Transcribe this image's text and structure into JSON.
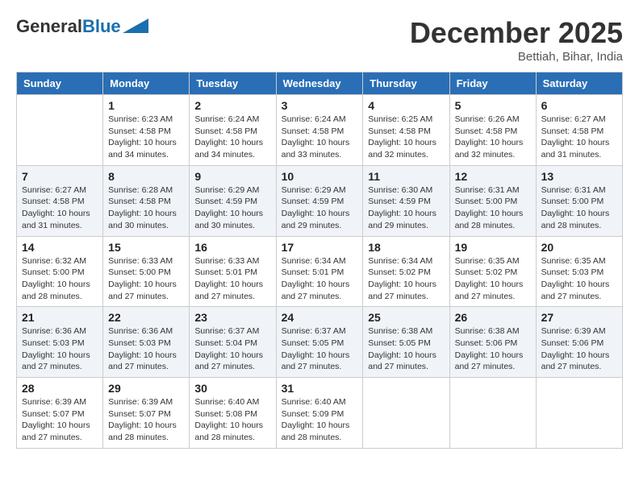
{
  "logo": {
    "part1": "General",
    "part2": "Blue",
    "arrow_color": "#1a6faf"
  },
  "title": "December 2025",
  "location": "Bettiah, Bihar, India",
  "days_of_week": [
    "Sunday",
    "Monday",
    "Tuesday",
    "Wednesday",
    "Thursday",
    "Friday",
    "Saturday"
  ],
  "weeks": [
    [
      {
        "day": "",
        "info": ""
      },
      {
        "day": "1",
        "info": "Sunrise: 6:23 AM\nSunset: 4:58 PM\nDaylight: 10 hours\nand 34 minutes."
      },
      {
        "day": "2",
        "info": "Sunrise: 6:24 AM\nSunset: 4:58 PM\nDaylight: 10 hours\nand 34 minutes."
      },
      {
        "day": "3",
        "info": "Sunrise: 6:24 AM\nSunset: 4:58 PM\nDaylight: 10 hours\nand 33 minutes."
      },
      {
        "day": "4",
        "info": "Sunrise: 6:25 AM\nSunset: 4:58 PM\nDaylight: 10 hours\nand 32 minutes."
      },
      {
        "day": "5",
        "info": "Sunrise: 6:26 AM\nSunset: 4:58 PM\nDaylight: 10 hours\nand 32 minutes."
      },
      {
        "day": "6",
        "info": "Sunrise: 6:27 AM\nSunset: 4:58 PM\nDaylight: 10 hours\nand 31 minutes."
      }
    ],
    [
      {
        "day": "7",
        "info": "Sunrise: 6:27 AM\nSunset: 4:58 PM\nDaylight: 10 hours\nand 31 minutes."
      },
      {
        "day": "8",
        "info": "Sunrise: 6:28 AM\nSunset: 4:58 PM\nDaylight: 10 hours\nand 30 minutes."
      },
      {
        "day": "9",
        "info": "Sunrise: 6:29 AM\nSunset: 4:59 PM\nDaylight: 10 hours\nand 30 minutes."
      },
      {
        "day": "10",
        "info": "Sunrise: 6:29 AM\nSunset: 4:59 PM\nDaylight: 10 hours\nand 29 minutes."
      },
      {
        "day": "11",
        "info": "Sunrise: 6:30 AM\nSunset: 4:59 PM\nDaylight: 10 hours\nand 29 minutes."
      },
      {
        "day": "12",
        "info": "Sunrise: 6:31 AM\nSunset: 5:00 PM\nDaylight: 10 hours\nand 28 minutes."
      },
      {
        "day": "13",
        "info": "Sunrise: 6:31 AM\nSunset: 5:00 PM\nDaylight: 10 hours\nand 28 minutes."
      }
    ],
    [
      {
        "day": "14",
        "info": "Sunrise: 6:32 AM\nSunset: 5:00 PM\nDaylight: 10 hours\nand 28 minutes."
      },
      {
        "day": "15",
        "info": "Sunrise: 6:33 AM\nSunset: 5:00 PM\nDaylight: 10 hours\nand 27 minutes."
      },
      {
        "day": "16",
        "info": "Sunrise: 6:33 AM\nSunset: 5:01 PM\nDaylight: 10 hours\nand 27 minutes."
      },
      {
        "day": "17",
        "info": "Sunrise: 6:34 AM\nSunset: 5:01 PM\nDaylight: 10 hours\nand 27 minutes."
      },
      {
        "day": "18",
        "info": "Sunrise: 6:34 AM\nSunset: 5:02 PM\nDaylight: 10 hours\nand 27 minutes."
      },
      {
        "day": "19",
        "info": "Sunrise: 6:35 AM\nSunset: 5:02 PM\nDaylight: 10 hours\nand 27 minutes."
      },
      {
        "day": "20",
        "info": "Sunrise: 6:35 AM\nSunset: 5:03 PM\nDaylight: 10 hours\nand 27 minutes."
      }
    ],
    [
      {
        "day": "21",
        "info": "Sunrise: 6:36 AM\nSunset: 5:03 PM\nDaylight: 10 hours\nand 27 minutes."
      },
      {
        "day": "22",
        "info": "Sunrise: 6:36 AM\nSunset: 5:03 PM\nDaylight: 10 hours\nand 27 minutes."
      },
      {
        "day": "23",
        "info": "Sunrise: 6:37 AM\nSunset: 5:04 PM\nDaylight: 10 hours\nand 27 minutes."
      },
      {
        "day": "24",
        "info": "Sunrise: 6:37 AM\nSunset: 5:05 PM\nDaylight: 10 hours\nand 27 minutes."
      },
      {
        "day": "25",
        "info": "Sunrise: 6:38 AM\nSunset: 5:05 PM\nDaylight: 10 hours\nand 27 minutes."
      },
      {
        "day": "26",
        "info": "Sunrise: 6:38 AM\nSunset: 5:06 PM\nDaylight: 10 hours\nand 27 minutes."
      },
      {
        "day": "27",
        "info": "Sunrise: 6:39 AM\nSunset: 5:06 PM\nDaylight: 10 hours\nand 27 minutes."
      }
    ],
    [
      {
        "day": "28",
        "info": "Sunrise: 6:39 AM\nSunset: 5:07 PM\nDaylight: 10 hours\nand 27 minutes."
      },
      {
        "day": "29",
        "info": "Sunrise: 6:39 AM\nSunset: 5:07 PM\nDaylight: 10 hours\nand 28 minutes."
      },
      {
        "day": "30",
        "info": "Sunrise: 6:40 AM\nSunset: 5:08 PM\nDaylight: 10 hours\nand 28 minutes."
      },
      {
        "day": "31",
        "info": "Sunrise: 6:40 AM\nSunset: 5:09 PM\nDaylight: 10 hours\nand 28 minutes."
      },
      {
        "day": "",
        "info": ""
      },
      {
        "day": "",
        "info": ""
      },
      {
        "day": "",
        "info": ""
      }
    ]
  ]
}
